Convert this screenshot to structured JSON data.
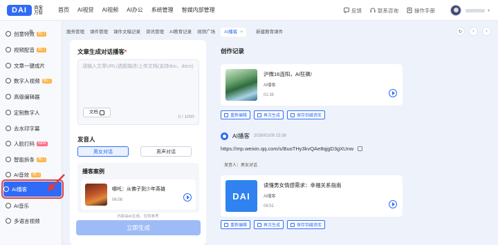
{
  "topbar": {
    "logo_mark": "DAI",
    "logo_text": "商宝万智",
    "nav": [
      "首页",
      "AI视觉",
      "AI视频",
      "AI办公",
      "系统管理",
      "智媒内部管理"
    ],
    "feedback": "反馈",
    "contact": "联系咨询",
    "manual": "操作手册"
  },
  "sidebar": {
    "items": [
      {
        "label": "创意特效",
        "badge": "热门"
      },
      {
        "label": "视频配音",
        "badge": "热门"
      },
      {
        "label": "文章一键成片",
        "badge": ""
      },
      {
        "label": "数字人视频",
        "badge": "热门"
      },
      {
        "label": "高级编辑器",
        "badge": ""
      },
      {
        "label": "定制数字人",
        "badge": ""
      },
      {
        "label": "去水印字幕",
        "badge": ""
      },
      {
        "label": "人脸打码",
        "badge": "NEW"
      },
      {
        "label": "智能拆条",
        "badge": "热门"
      },
      {
        "label": "AI音效",
        "badge": "热门"
      },
      {
        "label": "AI播客",
        "badge": ""
      },
      {
        "label": "AI音乐",
        "badge": ""
      },
      {
        "label": "多语言视频",
        "badge": ""
      }
    ]
  },
  "tabs": {
    "items": [
      "服务管理",
      "课件管理",
      "课件文稿记录",
      "资讯管理",
      "AI教育记录",
      "视频广场"
    ],
    "active": "AI播客",
    "after": "新建教育课件"
  },
  "left": {
    "title": "文章生成对话播客",
    "required_mark": "*",
    "placeholder": "请输入文章URL/选题描述/上传文档(支持doc、docx)",
    "doc_button": "文档",
    "counter": "0 / 1000",
    "speaker_title": "发音人",
    "seg_on": "男女对话",
    "seg_off": "男声对话",
    "case_title": "播客案例",
    "case_name": "哪吒：从佛子到少年英雄",
    "case_time": "06:08",
    "hint": "内容由AI生成，仅供参考",
    "generate_button": "立即生成"
  },
  "right": {
    "title": "创作记录",
    "work1": {
      "name": "沪微16连阳，AI狂飙!",
      "tag": "AI播客",
      "time": "01:36"
    },
    "actions": [
      "重新编辑",
      "再次生成",
      "保存到媒资库"
    ],
    "entry": {
      "name": "AI播客",
      "date": "2026/01/09 15:38",
      "url": "https://mp.weixin.qq.com/s/BuoTHy3kvQAe8qjgD3gXUnw",
      "speaker": "发音人：男女对话"
    },
    "work2": {
      "name": "读懂男女情感需求：幸福关系指南",
      "tag": "AI播客",
      "time": "08:51",
      "thumb_text": "DAI"
    }
  },
  "colors": {
    "accent": "#2f6bf6",
    "highlight": "#e53b3b",
    "disabled_button": "#9dbcf7"
  }
}
